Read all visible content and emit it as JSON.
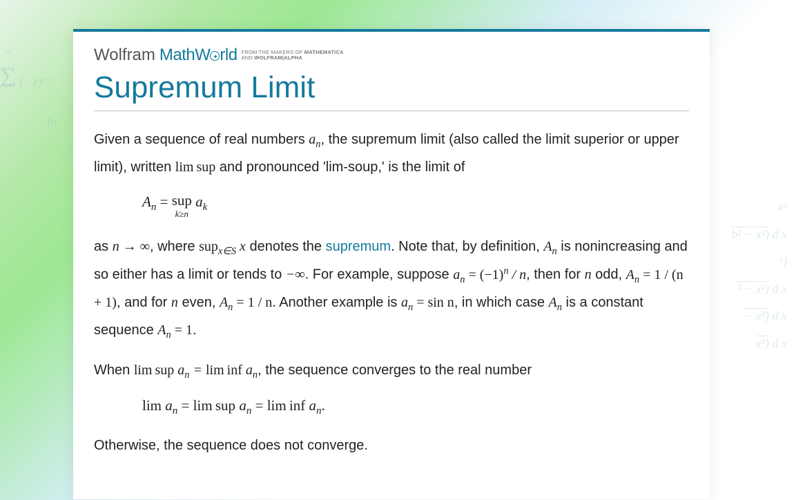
{
  "logo": {
    "part1": "Wolfram",
    "part2": "MathW",
    "part3": "rld",
    "sub_line1_a": "FROM THE MAKERS OF ",
    "sub_line1_b": "MATHEMATICA",
    "sub_line2_a": "AND ",
    "sub_line2_b": "WOLFRAM|ALPHA"
  },
  "title": "Supremum Limit",
  "p1_a": "Given a sequence of real numbers ",
  "p1_an": "a",
  "p1_an_sub": "n",
  "p1_b": ", the supremum limit (also called the limit superior or upper limit), written ",
  "p1_limsup": "lim sup",
  "p1_c": " and pronounced 'lim-soup,' is the limit of",
  "eq1_lhs_A": "A",
  "eq1_lhs_sub": "n",
  "eq1_eq": " = ",
  "eq1_sup": "sup",
  "eq1_below": "k≥n",
  "eq1_rhs_a": " a",
  "eq1_rhs_sub": "k",
  "p2_a": "as ",
  "p2_ninf": "n → ∞",
  "p2_b": ", where ",
  "p2_supx": "sup",
  "p2_supx_sub": "x∈S",
  "p2_supx_x": " x",
  "p2_c": " denotes the ",
  "p2_link": "supremum",
  "p2_d": ". Note that, by definition, ",
  "p2_An": "A",
  "p2_An_sub": "n",
  "p2_e": " is nonincreasing and so either has a limit or tends to ",
  "p2_minf": "−∞",
  "p2_f": ". For example, suppose ",
  "p2_ex1_a": "a",
  "p2_ex1_sub": "n",
  "p2_ex1_eq": " = (−1)",
  "p2_ex1_exp": "n",
  "p2_ex1_rest": " / n",
  "p2_g": ", then for ",
  "p2_nodd": "n",
  "p2_h": " odd, ",
  "p2_Aodd": "A",
  "p2_Aodd_sub": "n",
  "p2_Aodd_eq": " = 1 / (n + 1)",
  "p2_i": ", and for ",
  "p2_neven": "n",
  "p2_j": " even, ",
  "p2_Aeven": "A",
  "p2_Aeven_sub": "n",
  "p2_Aeven_eq": " = 1 / n",
  "p2_k": ". Another example is ",
  "p2_sin_a": "a",
  "p2_sin_sub": "n",
  "p2_sin_eq": " = sin n",
  "p2_l": ", in which case ",
  "p2_sin_An": "A",
  "p2_sin_An_sub": "n",
  "p2_m": " is a constant sequence ",
  "p2_An1": "A",
  "p2_An1_sub": "n",
  "p2_An1_eq": " = 1",
  "p2_end": ".",
  "p3_a": "When ",
  "p3_ls": "lim sup ",
  "p3_ls_a": "a",
  "p3_ls_sub": "n",
  "p3_eq": " = ",
  "p3_li": "lim inf ",
  "p3_li_a": "a",
  "p3_li_sub": "n",
  "p3_b": ", the sequence converges to the real number",
  "eq2_lim": "lim ",
  "eq2_a1": "a",
  "eq2_s1": "n",
  "eq2_eq1": " = ",
  "eq2_ls": "lim sup ",
  "eq2_a2": "a",
  "eq2_s2": "n",
  "eq2_eq2": " = ",
  "eq2_li": "lim inf ",
  "eq2_a3": "a",
  "eq2_s3": "n",
  "eq2_end": ".",
  "p4": "Otherwise, the sequence does not converge.",
  "bg_left_sigma": "Σ",
  "bg_left_sup": "∞",
  "bg_left_expr": "(−1)",
  "bg_left_exp": "k−1",
  "bg_left_k": "k=1",
  "bg_left_ln": "−ln",
  "bg_right_1": "x²",
  "bg_right_2": "b² − x²)",
  "bg_right_dx": "d x",
  "bg_right_3": "²)",
  "bg_right_4": "² − x²)",
  "bg_right_5": "− x²)",
  "bg_right_6": "x²)"
}
